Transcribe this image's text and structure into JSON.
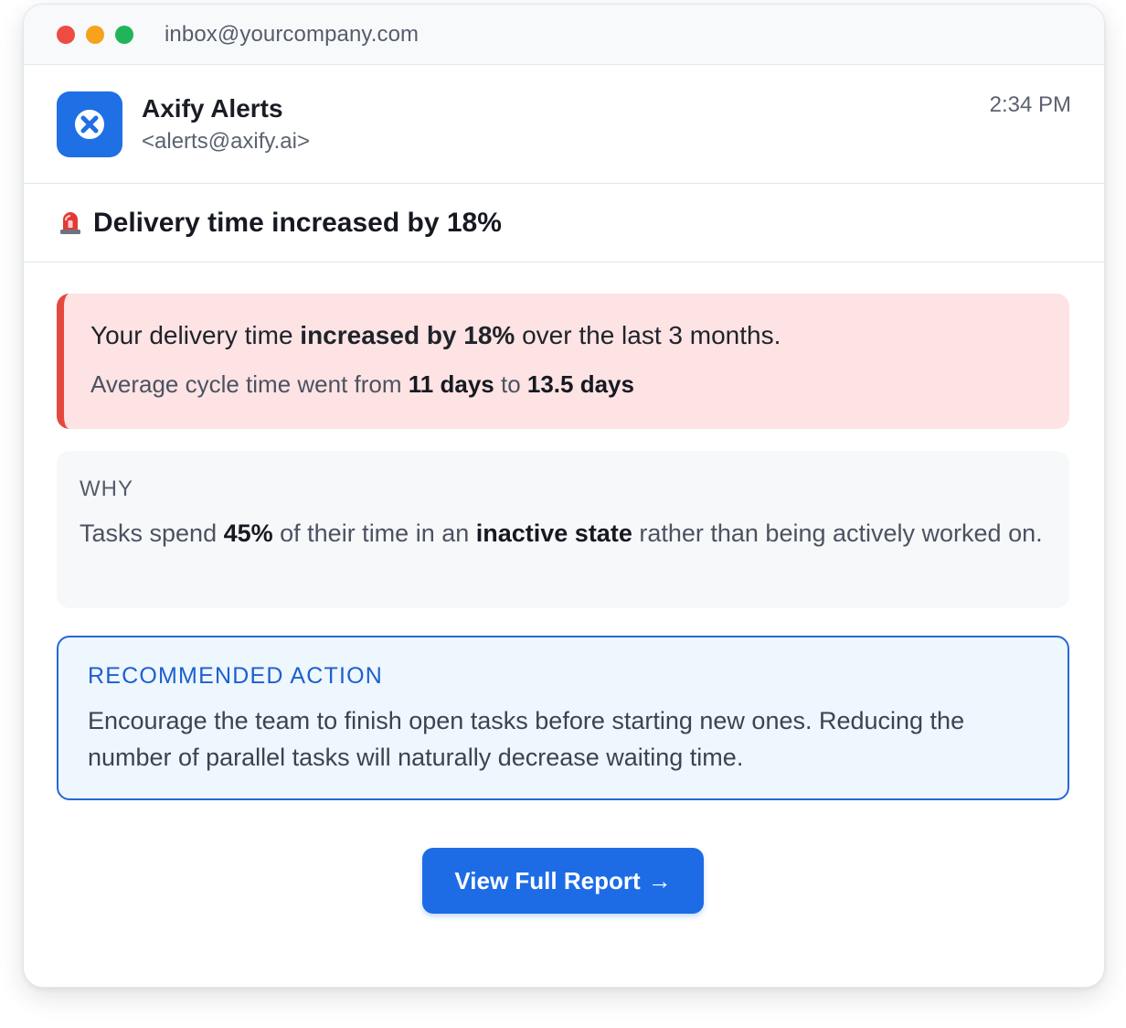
{
  "window": {
    "address": "inbox@yourcompany.com",
    "traffic_lights": [
      "close",
      "minimize",
      "maximize"
    ]
  },
  "sender": {
    "logo_icon": "axify-logo-icon",
    "name": "Axify Alerts",
    "email": "<alerts@axify.ai>",
    "time": "2:34 PM"
  },
  "subject": {
    "icon": "siren-emoji-icon",
    "text": "Delivery time increased by 18%"
  },
  "alert": {
    "line1_prefix": "Your delivery time ",
    "line1_bold": "increased by 18%",
    "line1_suffix": " over the last 3 months.",
    "line2_prefix": "Average cycle time went from ",
    "line2_from": "11 days",
    "line2_mid": " to ",
    "line2_to": "13.5 days"
  },
  "why": {
    "label": "WHY",
    "text_1": "Tasks spend ",
    "bold_1": "45%",
    "text_2": " of their time in an ",
    "bold_2": "inactive state",
    "text_3": " rather than being actively worked on."
  },
  "recommendation": {
    "label": "RECOMMENDED ACTION",
    "text": "Encourage the team to finish open tasks before starting new ones. Reducing the number of parallel tasks will naturally decrease waiting time."
  },
  "cta": {
    "label": "View Full Report",
    "arrow": "→"
  },
  "colors": {
    "brand_blue": "#1d6ce6",
    "alert_bg": "#fde3e3",
    "alert_accent": "#e5483e",
    "recommend_bg": "#eef6fe",
    "recommend_border": "#2568d6"
  }
}
